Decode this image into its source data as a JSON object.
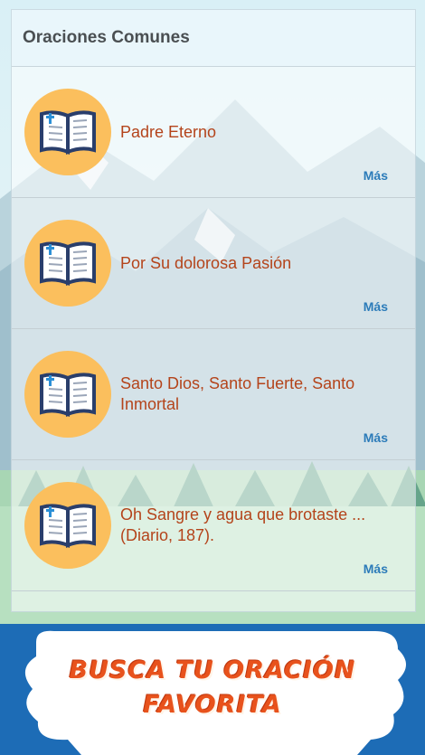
{
  "header": {
    "title": "Oraciones Comunes"
  },
  "prayers": [
    {
      "title": "Padre Eterno",
      "more_label": "Más"
    },
    {
      "title": "Por Su dolorosa Pasión",
      "more_label": "Más"
    },
    {
      "title": "Santo Dios, Santo Fuerte, Santo Inmortal",
      "more_label": "Más"
    },
    {
      "title": "Oh Sangre y agua que brotaste ... (Diario, 187).",
      "more_label": "Más"
    }
  ],
  "icons": {
    "prayer_icon": "open-bible-icon"
  },
  "banner": {
    "line1": "BUSCA TU ORACIÓN",
    "line2": "FAVORITA"
  },
  "colors": {
    "accent": "#2b7bb9",
    "title": "#b4441b",
    "banner_bg": "#1d6cb6",
    "icon_circle": "#fbbf5d"
  }
}
